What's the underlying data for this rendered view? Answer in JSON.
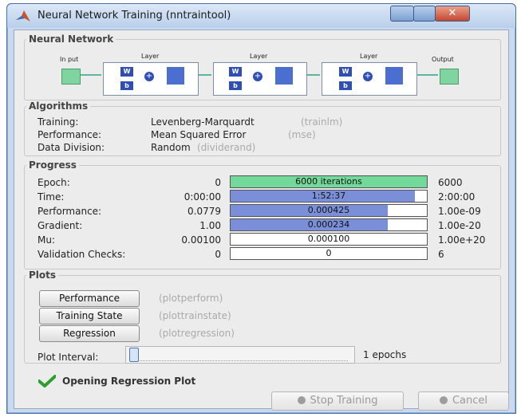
{
  "window": {
    "title": "Neural Network Training (nntraintool)",
    "close_label": "✕"
  },
  "network": {
    "legend": "Neural Network",
    "input_label": "In put",
    "output_label": "Output",
    "layer_label": "Layer",
    "w_label": "W",
    "b_label": "b",
    "plus_label": "+"
  },
  "algorithms": {
    "legend": "Algorithms",
    "rows": [
      {
        "label": "Training:",
        "value": "Levenberg-Marquardt",
        "func": "(trainlm)"
      },
      {
        "label": "Performance:",
        "value": "Mean Squared Error",
        "func": "(mse)"
      },
      {
        "label": "Data Division:",
        "value": "Random",
        "func": "(dividerand)"
      }
    ]
  },
  "progress": {
    "legend": "Progress",
    "rows": [
      {
        "label": "Epoch:",
        "start": "0",
        "current": "6000 iterations",
        "end": "6000",
        "fill": 1.0
      },
      {
        "label": "Time:",
        "start": "0:00:00",
        "current": "1:52:37",
        "end": "2:00:00",
        "fill": 0.94
      },
      {
        "label": "Performance:",
        "start": "0.0779",
        "current": "0.000425",
        "end": "1.00e-09",
        "fill": 0.8
      },
      {
        "label": "Gradient:",
        "start": "1.00",
        "current": "0.000234",
        "end": "1.00e-20",
        "fill": 0.8
      },
      {
        "label": "Mu:",
        "start": "0.00100",
        "current": "0.000100",
        "end": "1.00e+20",
        "fill": 0.0
      },
      {
        "label": "Validation Checks:",
        "start": "0",
        "current": "0",
        "end": "6",
        "fill": 0.0
      }
    ]
  },
  "plots": {
    "legend": "Plots",
    "buttons": [
      {
        "label": "Performance",
        "func": "(plotperform)"
      },
      {
        "label": "Training State",
        "func": "(plottrainstate)"
      },
      {
        "label": "Regression",
        "func": "(plotregression)"
      }
    ],
    "interval_label": "Plot Interval:",
    "interval_value": "1 epochs",
    "interval_level": 0.0
  },
  "status": {
    "message": "Opening Regression Plot"
  },
  "footer": {
    "stop_label": "Stop Training",
    "cancel_label": "Cancel"
  },
  "colors": {
    "progress_fill": "#7b8fd9",
    "epoch_fill": "#72d99a",
    "check": "#2e9e2e"
  }
}
